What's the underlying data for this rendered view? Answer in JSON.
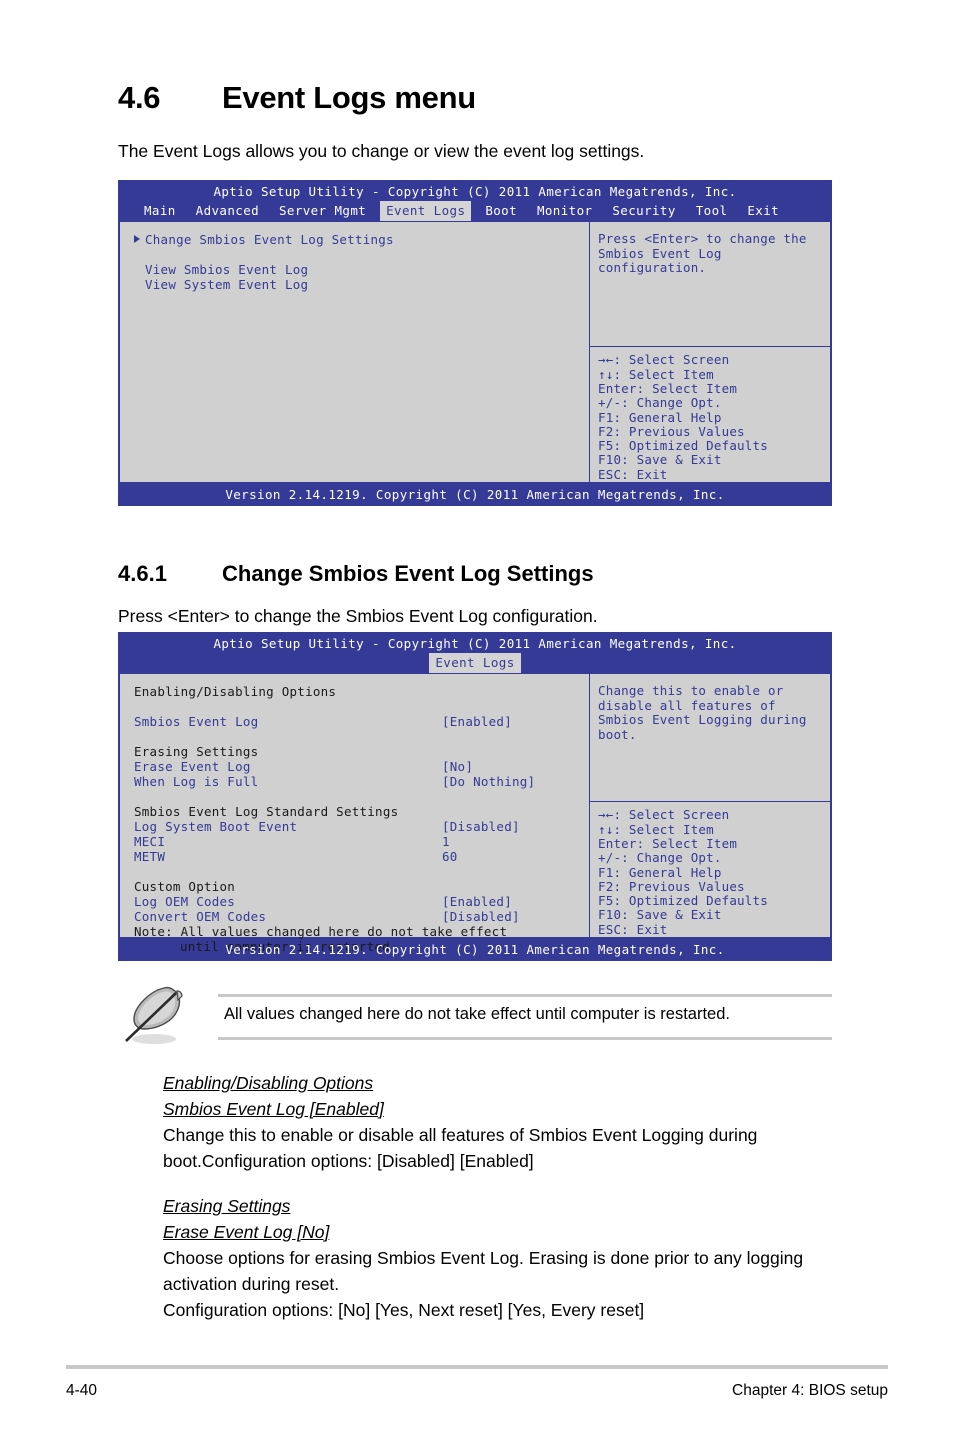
{
  "section": {
    "number": "4.6",
    "title": "Event Logs menu",
    "intro": "The Event Logs allows you to change or view the event log settings."
  },
  "subsection": {
    "number": "4.6.1",
    "title": "Change Smbios Event Log Settings",
    "intro": "Press <Enter> to change the Smbios Event Log configuration."
  },
  "bios_screen_1": {
    "title": "Aptio Setup Utility - Copyright (C) 2011 American Megatrends, Inc.",
    "menu": [
      {
        "label": "Main",
        "active": false
      },
      {
        "label": "Advanced",
        "active": false
      },
      {
        "label": "Server Mgmt",
        "active": false
      },
      {
        "label": "Event Logs",
        "active": true
      },
      {
        "label": "Boot",
        "active": false
      },
      {
        "label": "Monitor",
        "active": false
      },
      {
        "label": "Security",
        "active": false
      },
      {
        "label": "Tool",
        "active": false
      },
      {
        "label": "Exit",
        "active": false
      }
    ],
    "items": {
      "selected": "Change Smbios Event Log Settings",
      "sub1": "View Smbios Event Log",
      "sub2": "View System Event Log"
    },
    "help": "Press <Enter> to change the Smbios Event Log configuration.",
    "keys": [
      "→←: Select Screen",
      "↑↓:  Select Item",
      "Enter: Select Item",
      "+/-: Change Opt.",
      "F1: General Help",
      "F2: Previous Values",
      "F5: Optimized Defaults",
      "F10: Save & Exit",
      "ESC: Exit"
    ],
    "footer": "Version 2.14.1219. Copyright (C) 2011 American Megatrends, Inc."
  },
  "bios_screen_2": {
    "title": "Aptio Setup Utility - Copyright (C) 2011 American Megatrends, Inc.",
    "menu": [
      {
        "label": "Event Logs",
        "active": true
      }
    ],
    "groups": {
      "g1_head": "Enabling/Disabling Options",
      "g1_rows": [
        {
          "name": "Smbios Event Log",
          "value": "[Enabled]"
        }
      ],
      "g2_head": "Erasing Settings",
      "g2_rows": [
        {
          "name": "Erase Event Log",
          "value": "[No]"
        },
        {
          "name": "When Log is Full",
          "value": "[Do Nothing]"
        }
      ],
      "g3_head": "Smbios Event Log Standard Settings",
      "g3_rows": [
        {
          "name": "Log System Boot Event",
          "value": "[Disabled]"
        },
        {
          "name": "MECI",
          "value": "1"
        },
        {
          "name": "METW",
          "value": "60"
        }
      ],
      "g4_head": "Custom Option",
      "g4_rows": [
        {
          "name": "Log OEM Codes",
          "value": "[Enabled]"
        },
        {
          "name": "Convert OEM Codes",
          "value": "[Disabled]"
        }
      ],
      "note_line1": "Note: All values changed here do not take effect",
      "note_line2": "until computer is restarted."
    },
    "help": "Change this to enable or disable all features of Smbios Event Logging during boot.",
    "keys": [
      "→←: Select Screen",
      "↑↓:  Select Item",
      "Enter: Select Item",
      "+/-: Change Opt.",
      "F1: General Help",
      "F2: Previous Values",
      "F5: Optimized Defaults",
      "F10: Save & Exit",
      "ESC: Exit"
    ],
    "footer": "Version 2.14.1219. Copyright (C) 2011 American Megatrends, Inc."
  },
  "note": {
    "text": "All values changed here do not take effect until computer is restarted."
  },
  "body": {
    "block1_head1": "Enabling/Disabling Options",
    "block1_head2": "Smbios Event Log [Enabled]",
    "block1_para": "Change this to enable or disable all features of Smbios Event Logging during boot.Configuration options: [Disabled] [Enabled]",
    "block2_head1": "Erasing Settings",
    "block2_head2": "Erase Event Log [No]",
    "block2_para1": "Choose options for erasing Smbios Event Log. Erasing is done prior to any logging activation during reset.",
    "block2_para2": "Configuration options: [No] [Yes, Next reset] [Yes, Every reset]"
  },
  "footer": {
    "page": "4-40",
    "chapter": "Chapter 4: BIOS setup"
  },
  "colors": {
    "bios_blue": "#343a95",
    "bios_gray": "#d0d0d0",
    "rule_gray": "#c8c8c8"
  }
}
